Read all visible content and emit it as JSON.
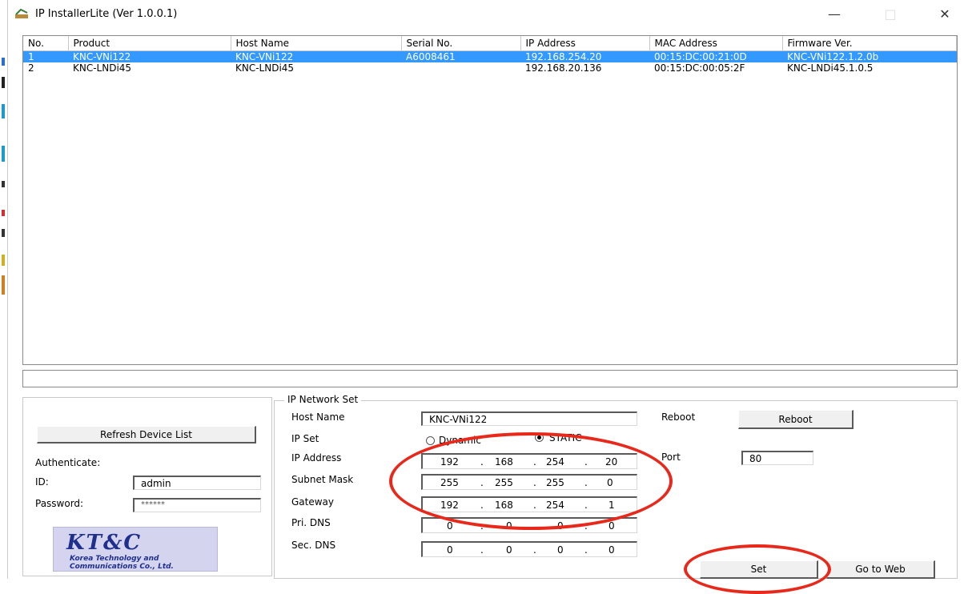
{
  "window": {
    "title": "IP InstallerLite (Ver 1.0.0.1)",
    "minimize": "—",
    "maximize": "□",
    "close": "✕"
  },
  "devices": {
    "columns": [
      "No.",
      "Product",
      "Host Name",
      "Serial No.",
      "IP Address",
      "MAC Address",
      "Firmware Ver."
    ],
    "rows": [
      [
        "1",
        "KNC-VNi122",
        "KNC-VNi122",
        "A6008461",
        "192.168.254.20",
        "00:15:DC:00:21:0D",
        "KNC-VNi122.1.2.0b"
      ],
      [
        "2",
        "KNC-LNDi45",
        "KNC-LNDi45",
        "",
        "192.168.20.136",
        "00:15:DC:00:05:2F",
        "KNC-LNDi45.1.0.5"
      ]
    ]
  },
  "left": {
    "refresh_label": "Refresh Device List",
    "auth_label": "Authenticate:",
    "id_label": "ID:",
    "id_value": "admin",
    "password_label": "Password:",
    "password_value": "******",
    "logo_main": "KT&C",
    "logo_line1": "Korea Technology and",
    "logo_line2": "Communications Co., Ltd."
  },
  "network": {
    "legend": "IP Network Set",
    "host_name_label": "Host Name",
    "host_name_value": "KNC-VNi122",
    "ip_set_label": "IP Set",
    "dynamic_label": "Dynamic",
    "static_label": "STATIC",
    "ip_address_label": "IP Address",
    "ip_address": [
      "192",
      "168",
      "254",
      "20"
    ],
    "subnet_label": "Subnet Mask",
    "subnet": [
      "255",
      "255",
      "255",
      "0"
    ],
    "gateway_label": "Gateway",
    "gateway": [
      "192",
      "168",
      "254",
      "1"
    ],
    "pri_dns_label": "Pri. DNS",
    "pri_dns": [
      "0",
      "0",
      "0",
      "0"
    ],
    "sec_dns_label": "Sec. DNS",
    "sec_dns": [
      "0",
      "0",
      "0",
      "0"
    ],
    "reboot_label": "Reboot",
    "reboot_button": "Reboot",
    "port_label": "Port",
    "port_value": "80",
    "set_button": "Set",
    "web_button": "Go to Web"
  },
  "colors": {
    "selection": "#3399ff",
    "annotation": "#e8281a"
  }
}
